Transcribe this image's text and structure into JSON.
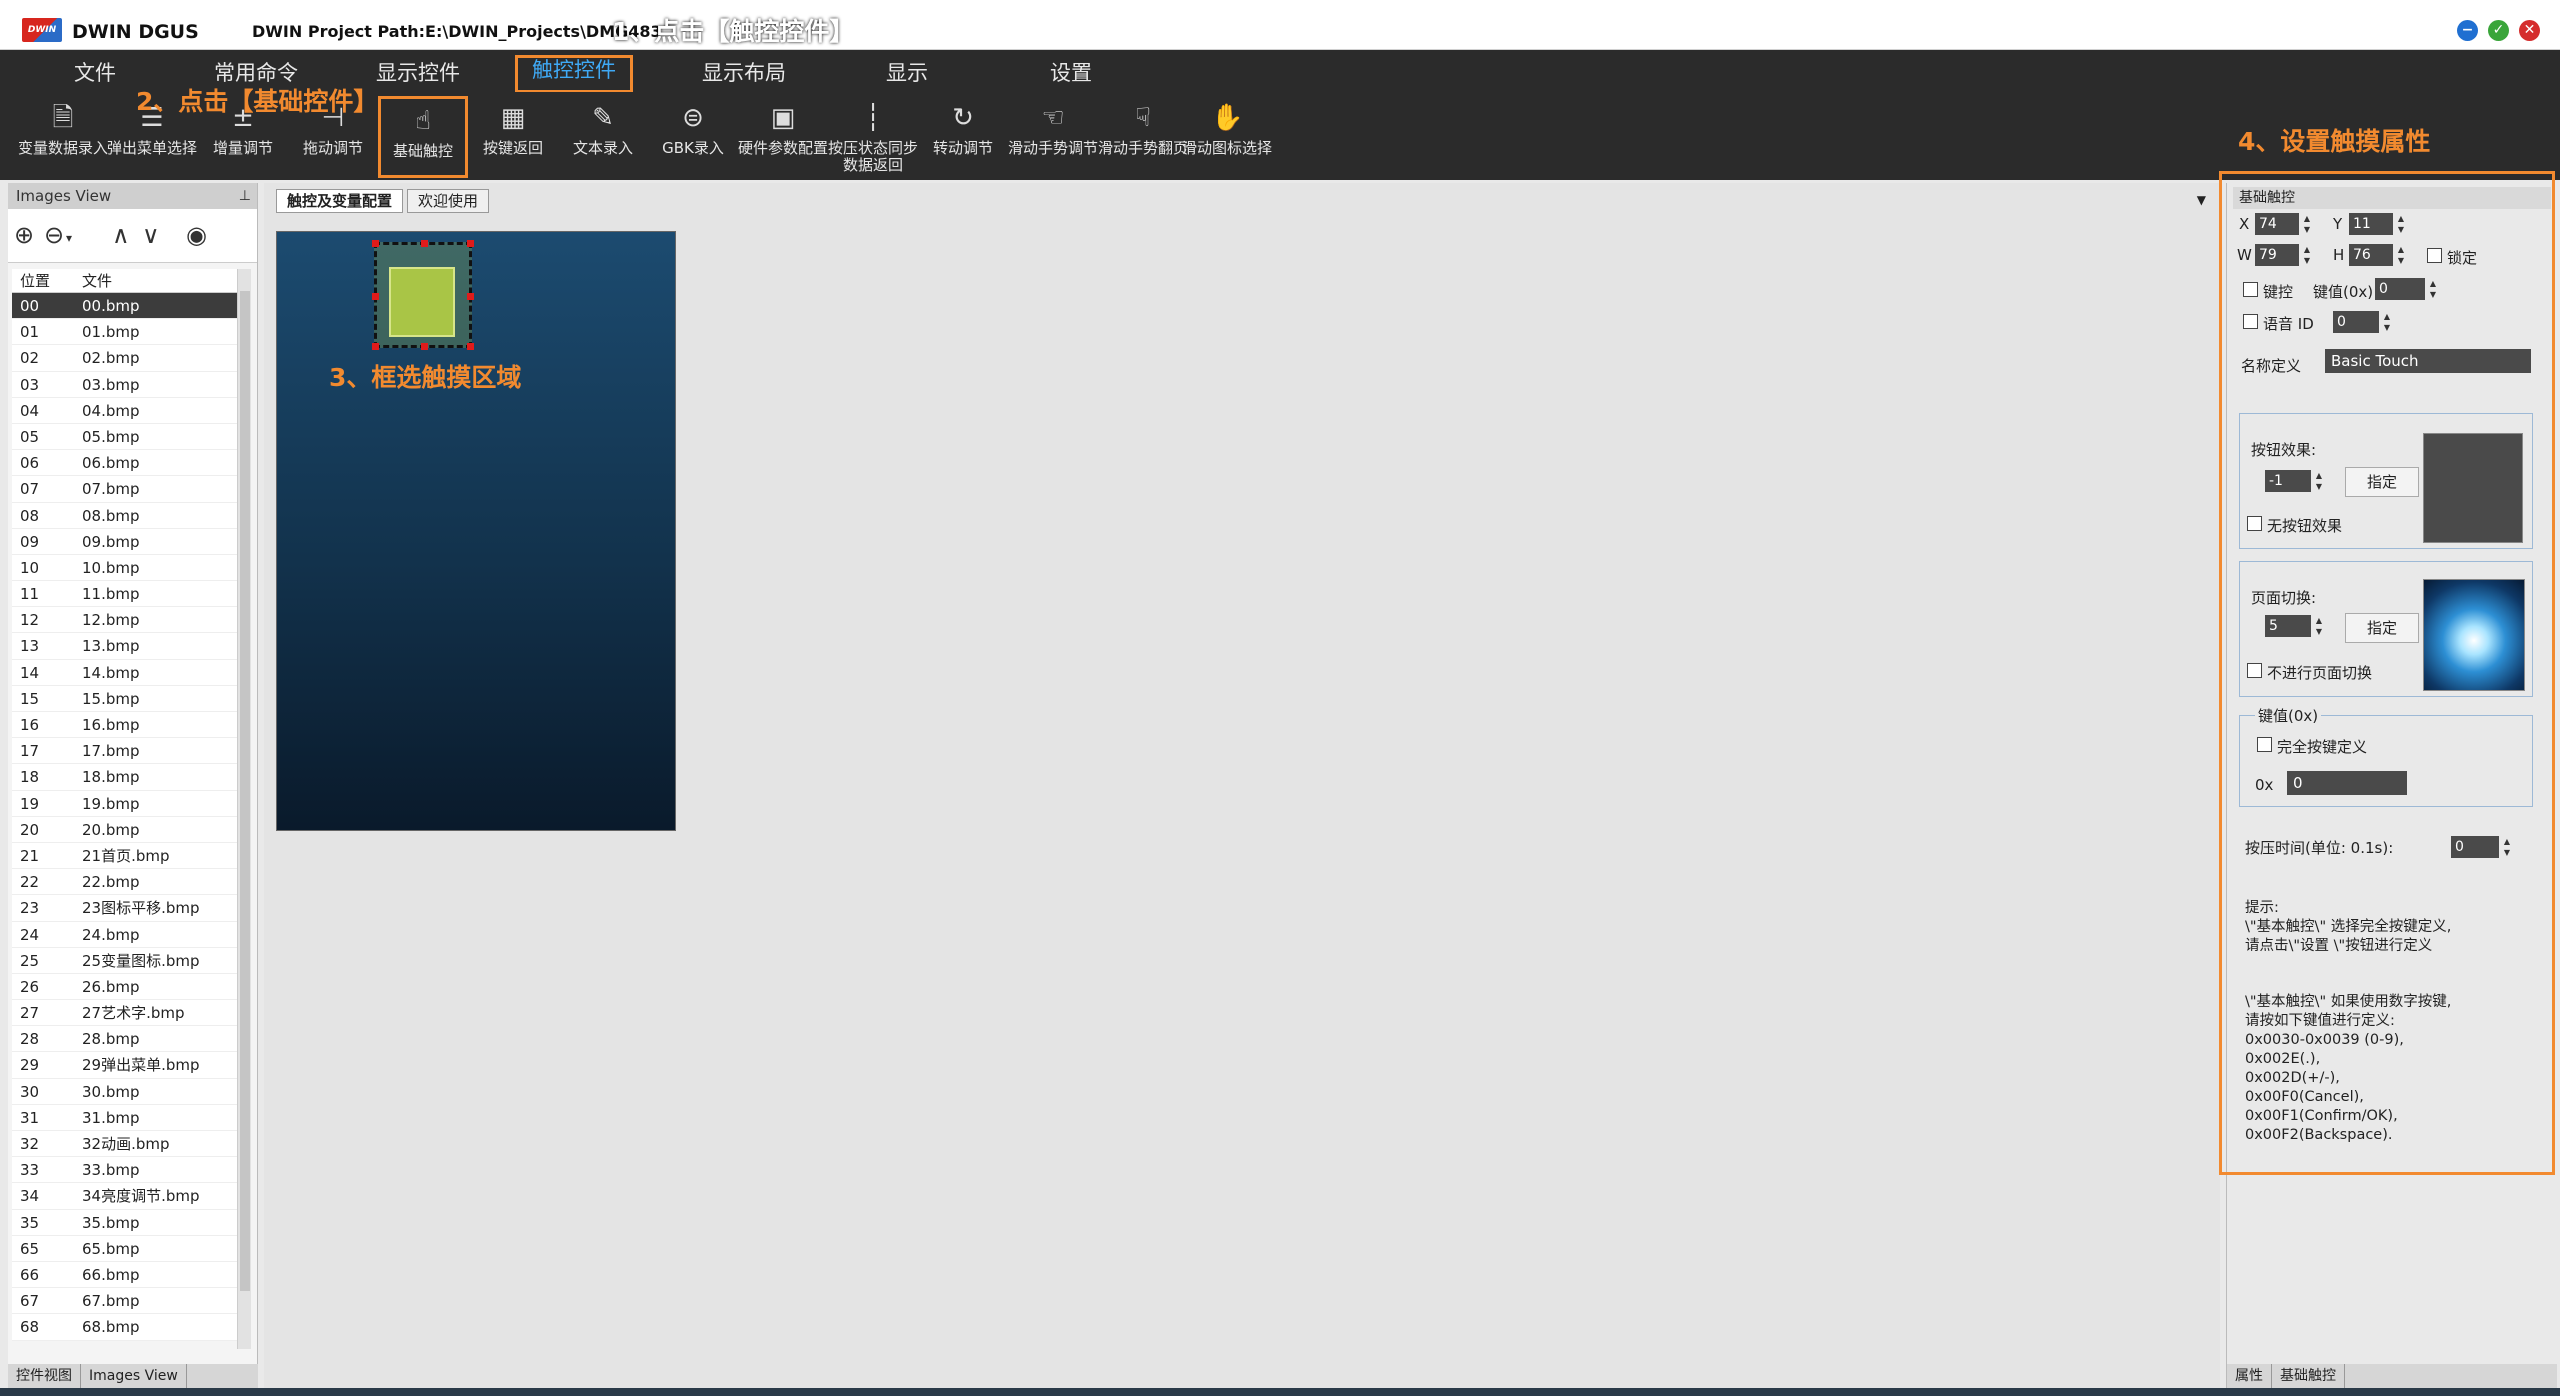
{
  "window": {
    "app_title": "DWIN DGUS",
    "project_path": "DWIN Project Path:E:\\DWIN_Projects\\DMG483",
    "logo_text": "DWIN",
    "controls": {
      "minimize": "−",
      "maximize": "✓",
      "close": "✕"
    }
  },
  "menu": {
    "items": [
      "文件",
      "常用命令",
      "显示控件",
      "触控控件",
      "显示布局",
      "显示",
      "设置"
    ],
    "active_index": 3
  },
  "toolbar": {
    "tools": [
      {
        "label": "变量数据录入",
        "icon": "edit-doc-icon"
      },
      {
        "label": "弹出菜单选择",
        "icon": "list-icon"
      },
      {
        "label": "增量调节",
        "icon": "increment-icon"
      },
      {
        "label": "拖动调节",
        "icon": "slider-icon"
      },
      {
        "label": "基础触控",
        "icon": "touch-icon"
      },
      {
        "label": "按键返回",
        "icon": "keypad-icon"
      },
      {
        "label": "文本录入",
        "icon": "pen-icon"
      },
      {
        "label": "GBK录入",
        "icon": "gbk-icon"
      },
      {
        "label": "硬件参数配置",
        "icon": "hardware-icon"
      },
      {
        "label": "按压状态同步数据返回",
        "icon": "pressure-icon"
      },
      {
        "label": "转动调节",
        "icon": "rotate-icon"
      },
      {
        "label": "滑动手势调节",
        "icon": "swipe-icon"
      },
      {
        "label": "滑动手势翻页",
        "icon": "swipe-page-icon"
      },
      {
        "label": "滑动图标选择",
        "icon": "hand-icon"
      }
    ],
    "highlight_index": 4
  },
  "annotations": {
    "step1": "1、点击【触控控件】",
    "step2": "2、点击【基础控件】",
    "step3": "3、框选触摸区域",
    "step4": "4、设置触摸属性"
  },
  "images_view": {
    "title": "Images View",
    "columns": [
      "位置",
      "文件"
    ],
    "rows": [
      [
        "00",
        "00.bmp"
      ],
      [
        "01",
        "01.bmp"
      ],
      [
        "02",
        "02.bmp"
      ],
      [
        "03",
        "03.bmp"
      ],
      [
        "04",
        "04.bmp"
      ],
      [
        "05",
        "05.bmp"
      ],
      [
        "06",
        "06.bmp"
      ],
      [
        "07",
        "07.bmp"
      ],
      [
        "08",
        "08.bmp"
      ],
      [
        "09",
        "09.bmp"
      ],
      [
        "10",
        "10.bmp"
      ],
      [
        "11",
        "11.bmp"
      ],
      [
        "12",
        "12.bmp"
      ],
      [
        "13",
        "13.bmp"
      ],
      [
        "14",
        "14.bmp"
      ],
      [
        "15",
        "15.bmp"
      ],
      [
        "16",
        "16.bmp"
      ],
      [
        "17",
        "17.bmp"
      ],
      [
        "18",
        "18.bmp"
      ],
      [
        "19",
        "19.bmp"
      ],
      [
        "20",
        "20.bmp"
      ],
      [
        "21",
        "21首页.bmp"
      ],
      [
        "22",
        "22.bmp"
      ],
      [
        "23",
        "23图标平移.bmp"
      ],
      [
        "24",
        "24.bmp"
      ],
      [
        "25",
        "25变量图标.bmp"
      ],
      [
        "26",
        "26.bmp"
      ],
      [
        "27",
        "27艺术字.bmp"
      ],
      [
        "28",
        "28.bmp"
      ],
      [
        "29",
        "29弹出菜单.bmp"
      ],
      [
        "30",
        "30.bmp"
      ],
      [
        "31",
        "31.bmp"
      ],
      [
        "32",
        "32动画.bmp"
      ],
      [
        "33",
        "33.bmp"
      ],
      [
        "34",
        "34亮度调节.bmp"
      ],
      [
        "35",
        "35.bmp"
      ],
      [
        "65",
        "65.bmp"
      ],
      [
        "66",
        "66.bmp"
      ],
      [
        "67",
        "67.bmp"
      ],
      [
        "68",
        "68.bmp"
      ]
    ],
    "selected_index": 0,
    "footer_tabs": [
      "控件视图",
      "Images View"
    ]
  },
  "center": {
    "tabs": [
      "触控及变量配置",
      "欢迎使用"
    ],
    "active_tab": 0
  },
  "props": {
    "header": "基础触控",
    "x_label": "X",
    "x_value": "74",
    "y_label": "Y",
    "y_value": "11",
    "w_label": "W",
    "w_value": "79",
    "h_label": "H",
    "h_value": "76",
    "lock_label": "锁定",
    "key_ctrl_label": "键控",
    "key_value_label": "键值(0x)",
    "key_value": "0",
    "voice_label": "语音 ID",
    "voice_value": "0",
    "name_label": "名称定义",
    "name_value": "Basic Touch",
    "btn_effect_label": "按钮效果:",
    "btn_effect_value": "-1",
    "assign_label": "指定",
    "no_btn_effect_label": "无按钮效果",
    "page_switch_label": "页面切换:",
    "page_switch_value": "5",
    "no_page_switch_label": "不进行页面切换",
    "keyval_group_label": "键值(0x)",
    "full_key_label": "完全按键定义",
    "hex_prefix": "0x",
    "hex_value": "0",
    "press_time_label": "按压时间(单位: 0.1s):",
    "press_time_value": "0",
    "hint1": "提示:\n\\\"基本触控\\\" 选择完全按键定义,\n请点击\\\"设置 \\\"按钮进行定义",
    "hint2": "\\\"基本触控\\\" 如果使用数字按键,\n请按如下键值进行定义:\n0x0030-0x0039 (0-9),\n0x002E(.),\n0x002D(+/-),\n0x00F0(Cancel),\n0x00F1(Confirm/OK),\n0x00F2(Backspace).",
    "footer_tabs": [
      "属性",
      "基础触控"
    ]
  }
}
